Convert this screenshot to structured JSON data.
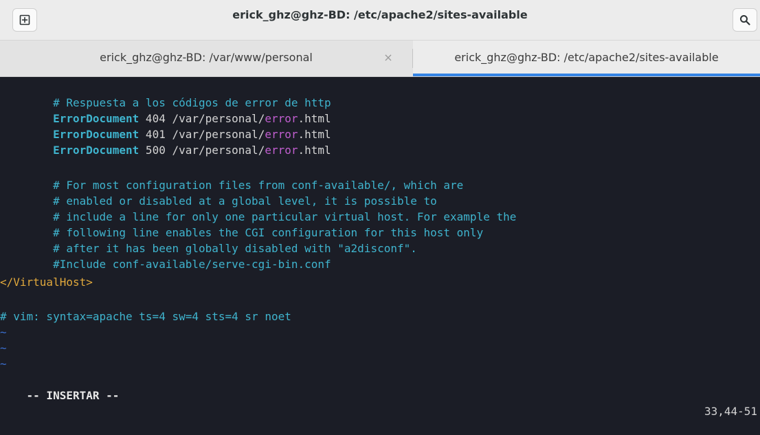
{
  "window": {
    "title": "erick_ghz@ghz-BD: /etc/apache2/sites-available",
    "new_tab_icon": "new-tab-icon",
    "search_icon": "search-icon"
  },
  "tabs": [
    {
      "label": "erick_ghz@ghz-BD: /var/www/personal",
      "close": "×"
    },
    {
      "label": "erick_ghz@ghz-BD: /etc/apache2/sites-available"
    }
  ],
  "editor": {
    "indent": "        ",
    "comment1": "# Respuesta a los códigos de error de http",
    "errdoc_kw": "ErrorDocument",
    "errdocs": [
      {
        "code": " 404 /var/personal/",
        "err": "error",
        "ext": ".html"
      },
      {
        "code": " 401 /var/personal/",
        "err": "error",
        "ext": ".html"
      },
      {
        "code": " 500 /var/personal/",
        "err": "error",
        "ext": ".html"
      }
    ],
    "comments": [
      "# For most configuration files from conf-available/, which are",
      "# enabled or disabled at a global level, it is possible to",
      "# include a line for only one particular virtual host. For example the",
      "# following line enables the CGI configuration for this host only",
      "# after it has been globally disabled with \"a2disconf\".",
      "#Include conf-available/serve-cgi-bin.conf"
    ],
    "close_tag": "</VirtualHost>",
    "modeline": "# vim: syntax=apache ts=4 sw=4 sts=4 sr noet",
    "tilde": "~"
  },
  "status": {
    "mode": "-- INSERTAR --",
    "position": "33,44-51"
  },
  "colors": {
    "background": "#1b1d26",
    "comment": "#3fb4ce",
    "keyword": "#3fb4ce",
    "error_word": "#c15fd0",
    "tag": "#e0a83c",
    "tilde": "#3b6fd0",
    "tab_accent": "#3584e4"
  }
}
